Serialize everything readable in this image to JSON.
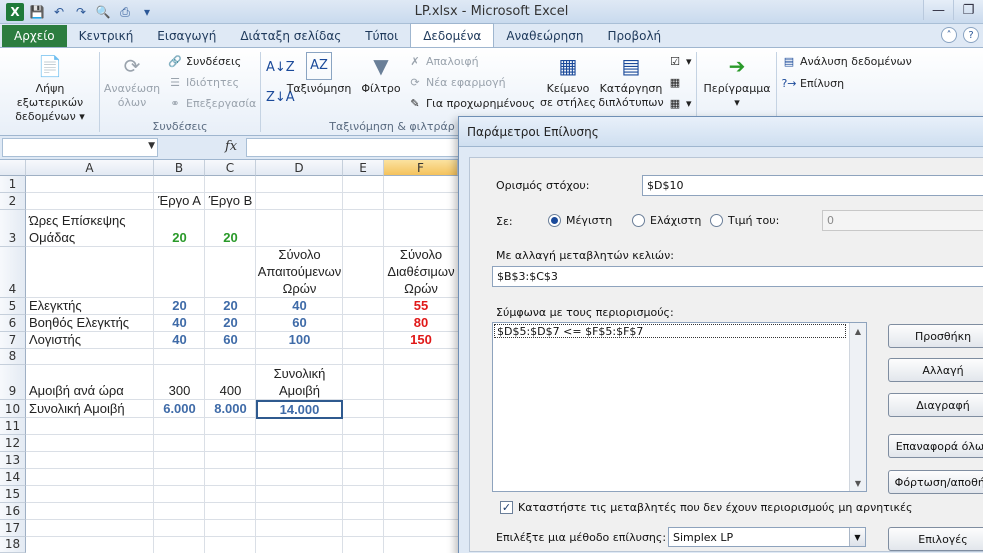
{
  "window": {
    "title": "LP.xlsx - Microsoft Excel"
  },
  "ribbon_tabs": [
    "Αρχείο",
    "Κεντρική",
    "Εισαγωγή",
    "Διάταξη σελίδας",
    "Τύποι",
    "Δεδομένα",
    "Αναθεώρηση",
    "Προβολή"
  ],
  "ribbon": {
    "get_external": "Λήψη εξωτερικών δεδομένων",
    "refresh_all": "Ανανέωση όλων",
    "connections": "Συνδέσεις",
    "properties": "Ιδιότητες",
    "edit_links": "Επεξεργασία",
    "connections_group": "Συνδέσεις",
    "sort": "Ταξινόμηση",
    "filter": "Φίλτρο",
    "clear": "Απαλοιφή",
    "reapply": "Νέα εφαρμογή",
    "advanced": "Για προχωρημένους",
    "sort_filter_group": "Ταξινόμηση & φιλτράρ",
    "text_to_columns": "Κείμενο σε στήλες",
    "remove_duplicates": "Κατάργηση διπλότυπων",
    "outline": "Περίγραμμα",
    "data_analysis": "Ανάλυση δεδομένων",
    "solver": "Επίλυση"
  },
  "formula_bar": {
    "fx": "fx",
    "value": ""
  },
  "columns": [
    "A",
    "B",
    "C",
    "D",
    "E",
    "F"
  ],
  "rows": [
    "1",
    "2",
    "3",
    "4",
    "5",
    "6",
    "7",
    "8",
    "9",
    "10",
    "11",
    "12",
    "13",
    "14",
    "15",
    "16",
    "17",
    "18"
  ],
  "sheet": {
    "b2": "Έργο Α",
    "c2": "Έργο Β",
    "a3": "Ώρες Επίσκεψης Ομάδας",
    "b3": "20",
    "c3": "20",
    "d4": "Σύνολο Απαιτούμενων Ωρών",
    "f4": "Σύνολο Διαθέσιμων Ωρών",
    "a5": "Ελεγκτής",
    "b5": "20",
    "c5": "20",
    "d5": "40",
    "f5": "55",
    "a6": "Βοηθός Ελεγκτής",
    "b6": "40",
    "c6": "20",
    "d6": "60",
    "f6": "80",
    "a7": "Λογιστής",
    "b7": "40",
    "c7": "60",
    "d7": "100",
    "f7": "150",
    "d9": "Συνολική Αμοιβή",
    "a9": "Αμοιβή ανά ώρα",
    "b9": "300",
    "c9": "400",
    "a10": "Συνολική Αμοιβή",
    "b10": "6.000",
    "c10": "8.000",
    "d10": "14.000"
  },
  "solver": {
    "title": "Παράμετροι Επίλυσης",
    "objective_label": "Ορισμός στόχου:",
    "objective_value": "$D$10",
    "to_label": "Σε:",
    "max": "Μέγιστη",
    "min": "Ελάχιστη",
    "value_of": "Τιμή του:",
    "value_of_input": "0",
    "changing_label": "Με αλλαγή μεταβλητών κελιών:",
    "changing_value": "$B$3:$C$3",
    "constraints_label": "Σύμφωνα με τους περιορισμούς:",
    "constraint_1": "$D$5:$D$7 <= $F$5:$F$7",
    "add": "Προσθήκη",
    "change": "Αλλαγή",
    "delete": "Διαγραφή",
    "reset": "Επαναφορά όλων",
    "load_save": "Φόρτωση/αποθήκ",
    "nonneg": "Καταστήστε τις μεταβλητές που δεν έχουν περιορισμούς μη αρνητικές",
    "method_label": "Επιλέξτε μια μέθοδο επίλυσης:",
    "method": "Simplex LP",
    "options": "Επιλογές"
  }
}
